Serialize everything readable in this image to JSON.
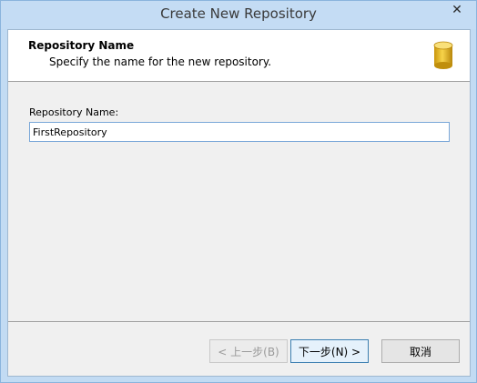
{
  "window": {
    "title": "Create New Repository",
    "close_glyph": "✕"
  },
  "header": {
    "title": "Repository Name",
    "subtitle": "Specify the name for the new repository.",
    "icon": "database-icon"
  },
  "form": {
    "label": "Repository Name:",
    "value": "FirstRepository"
  },
  "buttons": {
    "back": "< 上一步(B)",
    "next": "下一步(N) >",
    "cancel": "取消"
  },
  "colors": {
    "titlebar": "#c4dcf4",
    "input_border": "#7aa7d8",
    "db_icon": "#f2c522"
  }
}
